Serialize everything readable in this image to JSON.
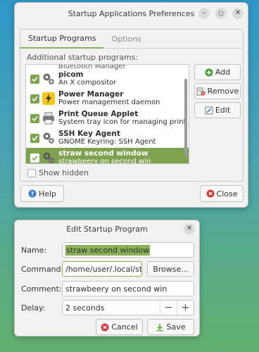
{
  "main_window": {
    "title": "Startup Applications Preferences",
    "tabs": [
      {
        "label": "Startup Programs",
        "active": true
      },
      {
        "label": "Options",
        "active": false
      }
    ],
    "section_label": "Additional startup programs:",
    "partial_row_text": "Bluetooth Manager",
    "programs": [
      {
        "name": "picom",
        "description": "An X compositor",
        "icon": "gears-icon",
        "checked": true
      },
      {
        "name": "Power Manager",
        "description": "Power management daemon",
        "icon": "lightning-icon",
        "checked": true
      },
      {
        "name": "Print Queue Applet",
        "description": "System tray icon for managing print jobs",
        "icon": "printer-icon",
        "checked": true
      },
      {
        "name": "SSH Key Agent",
        "description": "GNOME Keyring: SSH Agent",
        "icon": "gears-icon",
        "checked": true
      },
      {
        "name": "straw second window",
        "description": "strawbeery on second win",
        "icon": "gears-icon",
        "checked": true,
        "selected": true
      }
    ],
    "buttons": {
      "add": "Add",
      "remove": "Remove",
      "edit": "Edit",
      "help": "Help",
      "close": "Close"
    },
    "show_hidden_label": "Show hidden"
  },
  "edit_dialog": {
    "title": "Edit Startup Program",
    "name_label": "Name:",
    "name_value": "straw second window",
    "command_label": "Command:",
    "command_value": "/home/user/.local/straw",
    "browse_label": "Browse...",
    "comment_label": "Comment:",
    "comment_value": "strawbeery on second win",
    "delay_label": "Delay:",
    "delay_value": "2 seconds",
    "cancel_label": "Cancel",
    "save_label": "Save"
  },
  "colors": {
    "accent": "#7ea24f",
    "desktop_top": "#2f97c8",
    "desktop_bottom": "#62b06e",
    "add_icon": "#4a9a3a",
    "cancel_icon": "#d13b3b",
    "help_icon": "#3a7bd5"
  }
}
